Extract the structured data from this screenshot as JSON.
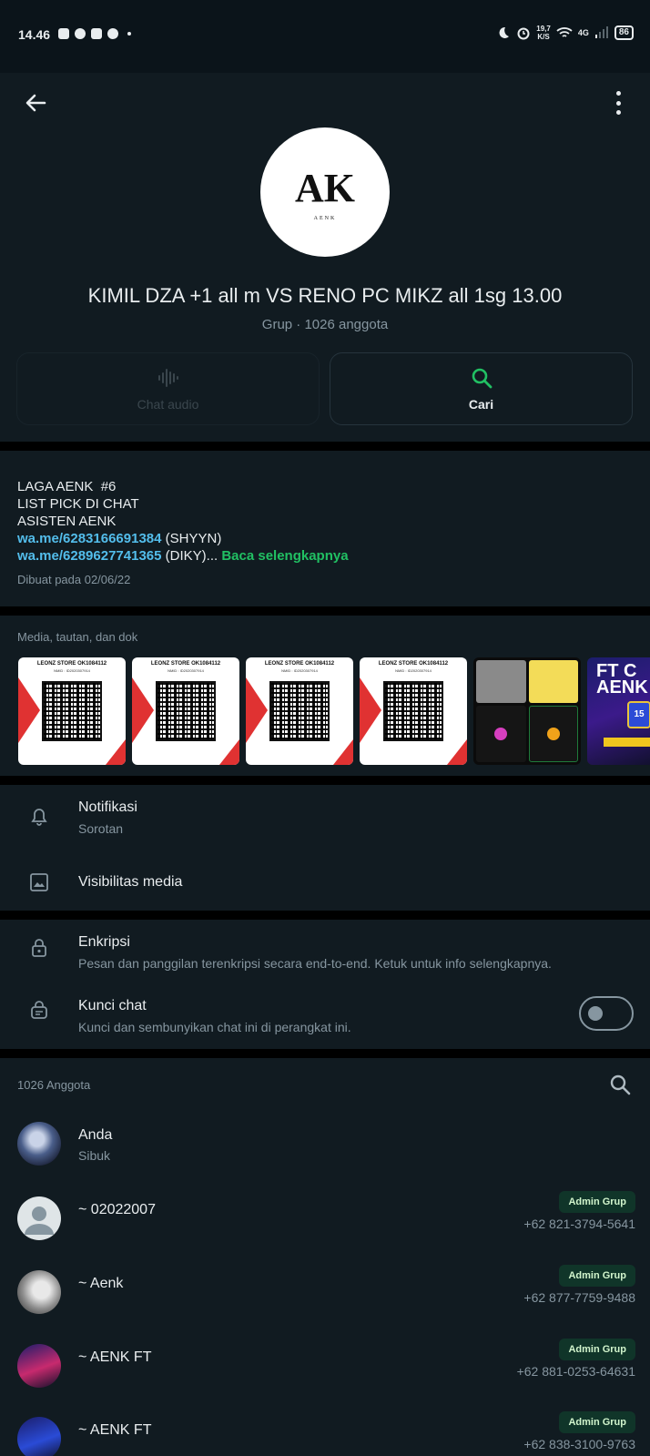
{
  "status_bar": {
    "time": "14.46",
    "net_speed_top": "19,7",
    "net_speed_bottom": "K/S",
    "network": "4G",
    "battery": "86"
  },
  "header": {
    "group_name": "KIMIL DZA +1 all m VS RENO PC MIKZ all 1sg 13.00",
    "subtitle": "Grup · 1026 anggota",
    "avatar_logo_text": "AK",
    "avatar_logo_caption": "AENK",
    "audio_label": "Chat audio",
    "search_label": "Cari"
  },
  "description": {
    "lines": [
      "LAGA AENK  #6",
      "LIST PICK DI CHAT",
      "ASISTEN AENK"
    ],
    "link1": "wa.me/6283166691384",
    "link1_suffix": " (SHYYN)",
    "link2": "wa.me/6289627741365",
    "link2_suffix": " (DIKY)... ",
    "read_more": "Baca selengkapnya",
    "created": "Dibuat pada 02/06/22"
  },
  "media": {
    "title": "Media, tautan, dan dok",
    "qr_store_title": "LEONZ STORE OK1084112",
    "qr_store_sub": "NMID : ID2020307914",
    "poster_title": "FT C AENK",
    "poster_badge": "15"
  },
  "settings": {
    "notifications_title": "Notifikasi",
    "notifications_sub": "Sorotan",
    "media_visibility_title": "Visibilitas media",
    "encryption_title": "Enkripsi",
    "encryption_sub": "Pesan dan panggilan terenkripsi secara end-to-end. Ketuk untuk info selengkapnya.",
    "lock_title": "Kunci chat",
    "lock_sub": "Kunci dan sembunyikan chat ini di perangkat ini.",
    "lock_enabled": false
  },
  "members": {
    "title": "1026 Anggota",
    "list": [
      {
        "name": "Anda",
        "sub": "Sibuk",
        "badge": "",
        "phone": ""
      },
      {
        "name": "~ 02022007",
        "sub": "",
        "badge": "Admin Grup",
        "phone": "+62 821-3794-5641"
      },
      {
        "name": "~ Aenk",
        "sub": "",
        "badge": "Admin Grup",
        "phone": "+62 877-7759-9488"
      },
      {
        "name": "~ AENK FT",
        "sub": "",
        "badge": "Admin Grup",
        "phone": "+62 881-0253-64631"
      },
      {
        "name": "~ AENK FT",
        "sub": "",
        "badge": "Admin Grup",
        "phone": "+62 838-3100-9763"
      }
    ]
  },
  "colors": {
    "background": "#0b141a",
    "panel": "#111b21",
    "accent_green": "#21c063",
    "link_blue": "#53bdeb"
  }
}
